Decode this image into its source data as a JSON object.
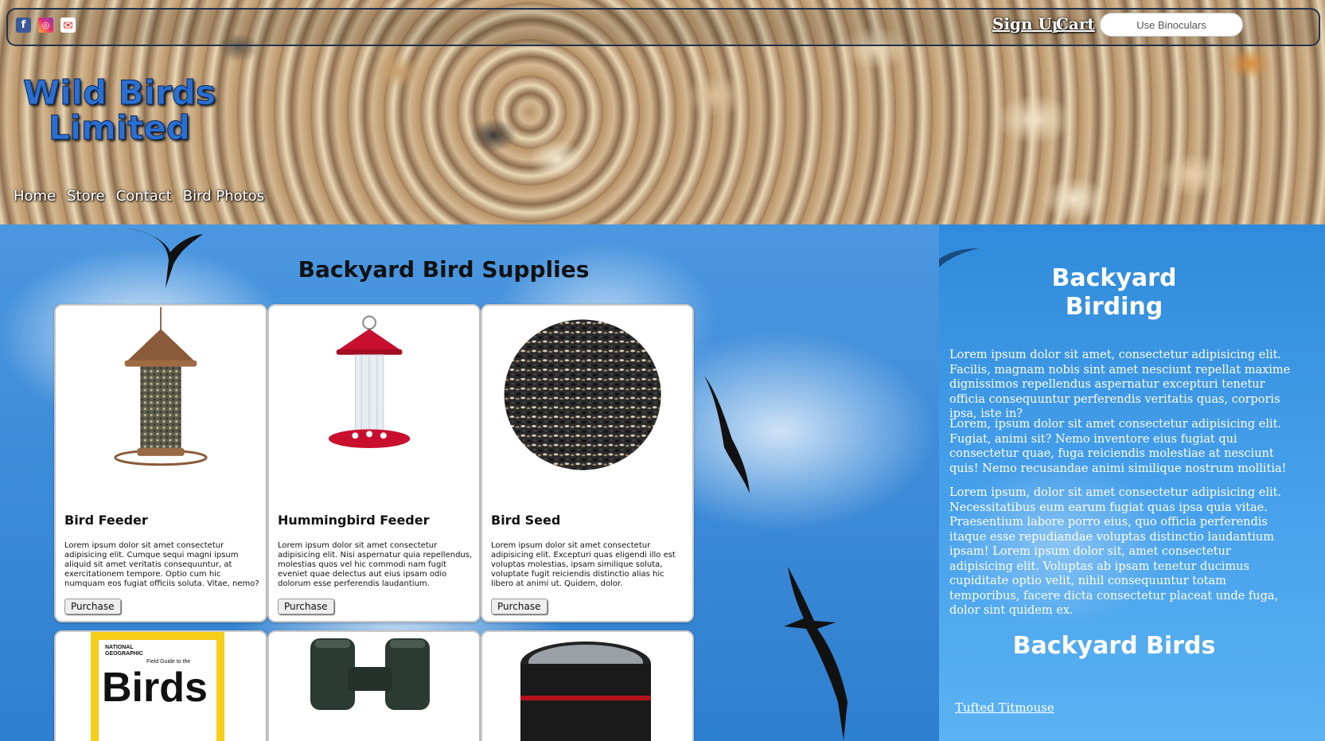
{
  "header": {
    "brand_title": "Wild Birds Limited",
    "social": {
      "facebook_icon": "facebook-icon",
      "instagram_icon": "instagram-icon",
      "mail_icon": "mail-icon"
    },
    "signup_label": "Sign Up",
    "cart_label": "Cart",
    "search_placeholder": "Use Binoculars",
    "nav": [
      "Home",
      "Store",
      "Contact",
      "Bird Photos"
    ]
  },
  "main": {
    "title": "Backyard Bird Supplies",
    "products": [
      {
        "name": "Bird Feeder",
        "description": "Lorem ipsum dolor sit amet consectetur adipisicing elit. Cumque sequi magni ipsum aliquid sit amet veritatis consequuntur, at exercitationem tempore. Optio cum hic numquam eos fugiat officiis soluta. Vitae, nemo?",
        "button": "Purchase"
      },
      {
        "name": "Hummingbird Feeder",
        "description": "Lorem ipsum dolor sit amet consectetur adipisicing elit. Nisi aspernatur quia repellendus, molestias quos vel hic commodi nam fugit eveniet quae delectus aut eius ipsam odio dolorum esse perferendis laudantium.",
        "button": "Purchase"
      },
      {
        "name": "Bird Seed",
        "description": "Lorem ipsum dolor sit amet consectetur adipisicing elit. Excepturi quas eligendi illo est voluptas molestias, ipsam similique soluta, voluptate fugit reiciendis distinctio alias hic libero at animi ut. Quidem, dolor.",
        "button": "Purchase"
      }
    ],
    "second_row": {
      "book_publisher": "NATIONAL GEOGRAPHIC",
      "book_subtitle": "Field Guide to the",
      "book_title": "Birds"
    }
  },
  "aside": {
    "title_line1": "Backyard",
    "title_line2": "Birding",
    "paragraphs": [
      "Lorem ipsum dolor sit amet, consectetur adipisicing elit. Facilis, magnam nobis sint amet nesciunt repellat maxime dignissimos repellendus aspernatur excepturi tenetur officia consequuntur perferendis veritatis quas, corporis ipsa, iste in?",
      "Lorem, ipsum dolor sit amet consectetur adipisicing elit. Fugiat, animi sit? Nemo inventore eius fugiat qui consectetur quae, fuga reiciendis molestiae at nesciunt quis! Nemo recusandae animi similique nostrum mollitia!",
      "Lorem ipsum, dolor sit amet consectetur adipisicing elit. Necessitatibus eum earum fugiat quas ipsa quia vitae. Praesentium labore porro eius, quo officia perferendis itaque esse repudiandae voluptas distinctio laudantium ipsam! Lorem ipsum dolor sit, amet consectetur adipisicing elit. Voluptas ab ipsam tenetur ducimus cupiditate optio velit, nihil consequuntur totam temporibus, facere dicta consectetur placeat unde fuga, dolor sint quidem ex."
    ],
    "birds_heading": "Backyard Birds",
    "bird_link": "Tufted Titmouse"
  }
}
